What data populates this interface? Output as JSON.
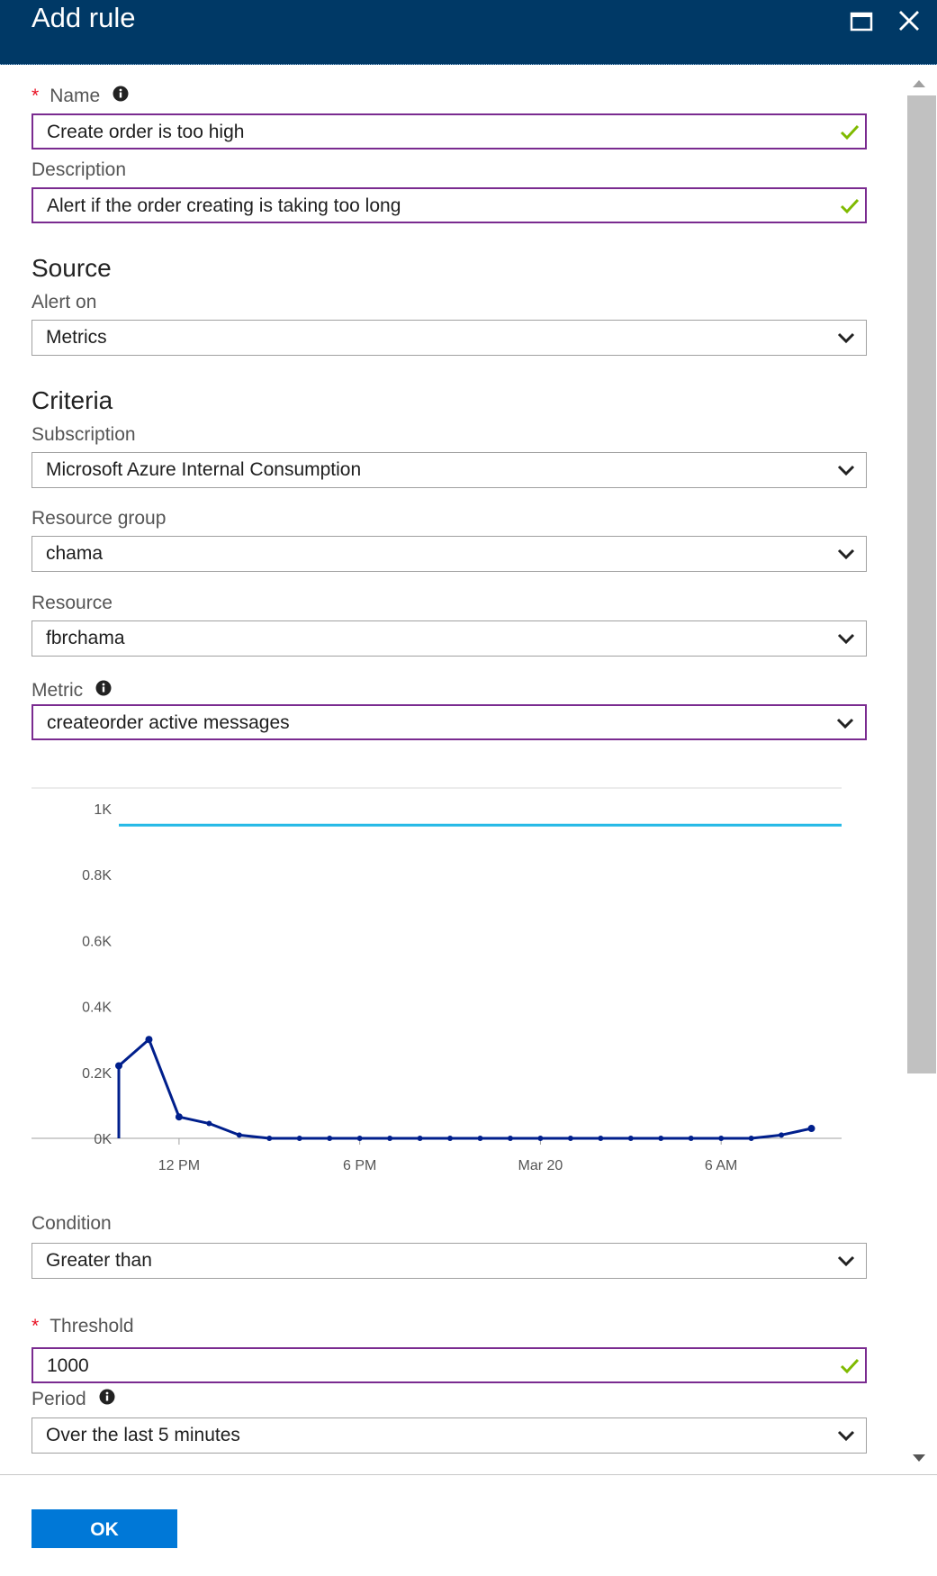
{
  "header": {
    "title": "Add rule",
    "maximize_icon": "maximize-icon",
    "close_icon": "close-icon"
  },
  "form": {
    "name": {
      "label": "Name",
      "required": "*",
      "value": "Create order is too high"
    },
    "description": {
      "label": "Description",
      "value": "Alert if the order creating is taking too long"
    },
    "source": {
      "title": "Source",
      "alert_on": {
        "label": "Alert on",
        "value": "Metrics"
      }
    },
    "criteria": {
      "title": "Criteria",
      "subscription": {
        "label": "Subscription",
        "value": "Microsoft Azure Internal Consumption"
      },
      "resource_group": {
        "label": "Resource group",
        "value": "chama"
      },
      "resource": {
        "label": "Resource",
        "value": "fbrchama"
      },
      "metric": {
        "label": "Metric",
        "value": "createorder active messages"
      }
    },
    "condition": {
      "label": "Condition",
      "value": "Greater than"
    },
    "threshold": {
      "label": "Threshold",
      "required": "*",
      "value": "1000"
    },
    "period": {
      "label": "Period",
      "value": "Over the last 5 minutes"
    }
  },
  "footer": {
    "ok_label": "OK"
  },
  "colors": {
    "header": "#003966",
    "accent": "#0078d7",
    "focus_border": "#7a2b90",
    "valid": "#7fba00",
    "series": "#001f8c",
    "threshold_line": "#25b9e6"
  },
  "chart_data": {
    "type": "line",
    "y_tick_labels": [
      "0K",
      "0.2K",
      "0.4K",
      "0.6K",
      "0.8K",
      "1K"
    ],
    "y_ticks": [
      0,
      200,
      400,
      600,
      800,
      1000
    ],
    "ylim": [
      0,
      1000
    ],
    "x_tick_labels": [
      "12 PM",
      "6 PM",
      "Mar 20",
      "6 AM"
    ],
    "x_tick_positions": [
      2,
      8,
      14,
      20
    ],
    "xlim": [
      0,
      24
    ],
    "threshold": 950,
    "series": [
      {
        "x": [
          0,
          1,
          2,
          3,
          4,
          5,
          6,
          7,
          8,
          9,
          10,
          11,
          12,
          13,
          14,
          15,
          16,
          17,
          18,
          19,
          20,
          21,
          22,
          23
        ],
        "values": [
          220,
          300,
          65,
          45,
          10,
          0,
          0,
          0,
          0,
          0,
          0,
          0,
          0,
          0,
          0,
          0,
          0,
          0,
          0,
          0,
          0,
          0,
          10,
          30
        ]
      }
    ]
  }
}
